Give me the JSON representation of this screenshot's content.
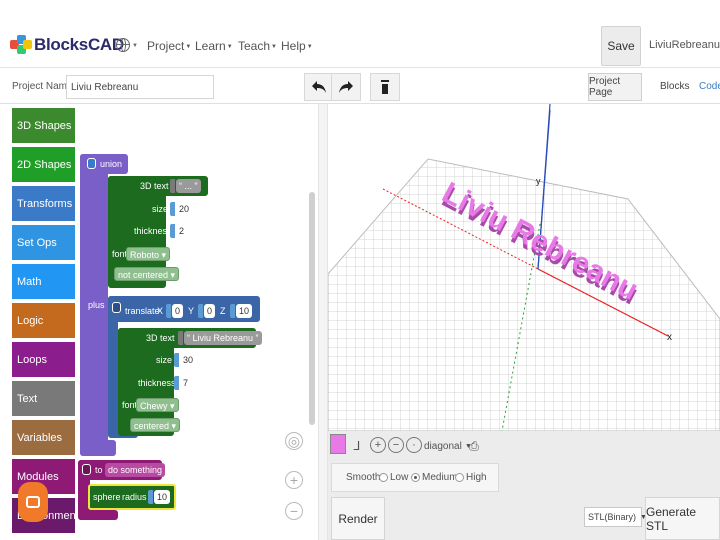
{
  "app": {
    "logo_text": "BlocksCAD"
  },
  "nav": {
    "items": [
      {
        "label": "Project"
      },
      {
        "label": "Learn"
      },
      {
        "label": "Teach"
      },
      {
        "label": "Help"
      }
    ],
    "save_label": "Save",
    "user": "LiviuRebreanu"
  },
  "project": {
    "name_label": "Project Name",
    "name_value": "Liviu Rebreanu",
    "page_button": "Project Page",
    "view_tabs": [
      {
        "label": "Blocks",
        "active": true
      },
      {
        "label": "Code",
        "active": false
      }
    ]
  },
  "toolbox": {
    "categories": [
      {
        "label": "3D Shapes",
        "color": "#3c8a2e"
      },
      {
        "label": "2D Shapes",
        "color": "#1f9e28"
      },
      {
        "label": "Transforms",
        "color": "#3a7ac6"
      },
      {
        "label": "Set Ops",
        "color": "#2f95e3"
      },
      {
        "label": "Math",
        "color": "#2196f3"
      },
      {
        "label": "Logic",
        "color": "#c46a1f"
      },
      {
        "label": "Loops",
        "color": "#8b1e8c"
      },
      {
        "label": "Text",
        "color": "#797979"
      },
      {
        "label": "Variables",
        "color": "#9b6c3f"
      },
      {
        "label": "Modules",
        "color": "#8e1a76"
      },
      {
        "label": "Environmental",
        "color": "#6b1a6b"
      }
    ]
  },
  "blocks": {
    "union_label": "union",
    "plus_label": "plus",
    "text1": {
      "title": "3D text",
      "text_value": "...",
      "size_label": "size",
      "size_value": "20",
      "thickness_label": "thickness",
      "thickness_value": "2",
      "font_label": "font",
      "font_value": "Roboto",
      "align_value": "not centered"
    },
    "translate": {
      "label": "translate",
      "x_label": "X",
      "x_value": "0",
      "y_label": "Y",
      "y_value": "0",
      "z_label": "Z",
      "z_value": "10"
    },
    "text2": {
      "title": "3D text",
      "text_value": "Liviu Rebreanu",
      "size_label": "size",
      "size_value": "30",
      "thickness_label": "thickness",
      "thickness_value": "7",
      "font_label": "font",
      "font_value": "Chewy",
      "align_value": "centered"
    },
    "module": {
      "to_label": "to",
      "name": "do something"
    },
    "sphere": {
      "label": "sphere",
      "radius_label": "radius",
      "radius_value": "10"
    }
  },
  "viewer": {
    "model_text": "Liviu Rebreanu",
    "axis_x_label": "x",
    "axis_y_label": "y",
    "view_label": "diagonal",
    "object_color": "#e87ae8"
  },
  "render_panel": {
    "smooth_label": "Smooth",
    "options": [
      {
        "label": "Low"
      },
      {
        "label": "Medium",
        "selected": true
      },
      {
        "label": "High"
      }
    ],
    "render_button": "Render",
    "format_value": "STL(Binary)",
    "generate_button": "Generate STL"
  }
}
